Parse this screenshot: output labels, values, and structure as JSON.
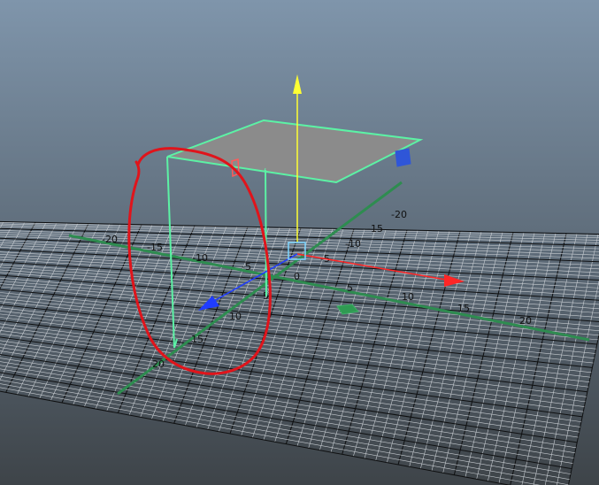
{
  "viewport": {
    "background_top": "#7f95ab",
    "background_bottom": "#3e4449",
    "grid_color": "#c8cdd2",
    "grid_major_color": "#0e0f10",
    "axis_color": "#2e8c50",
    "selection_color": "#5cf2a5",
    "top_face_color": "#8b8b8b",
    "manipulator": {
      "y_color": "#ffff33",
      "x_color": "#ff2626",
      "z_color": "#1f3cff",
      "center_color": "#7fd6ff"
    },
    "annotation_color": "#e0141b"
  },
  "grid_labels": {
    "x_pos_5": "5",
    "x_pos_10": "10",
    "x_pos_15": "15",
    "x_pos_20": "20",
    "x_neg_5": "-5",
    "x_neg_10": "-10",
    "x_neg_15": "-15",
    "x_neg_20": "-20",
    "z_pos_5": "5",
    "z_pos_10": "10",
    "z_pos_15": "15",
    "z_pos_20": "20",
    "z_neg_5": "-5",
    "z_neg_10": "-10",
    "z_neg_15": "-15",
    "z_neg_20": "-20",
    "origin": "0"
  }
}
